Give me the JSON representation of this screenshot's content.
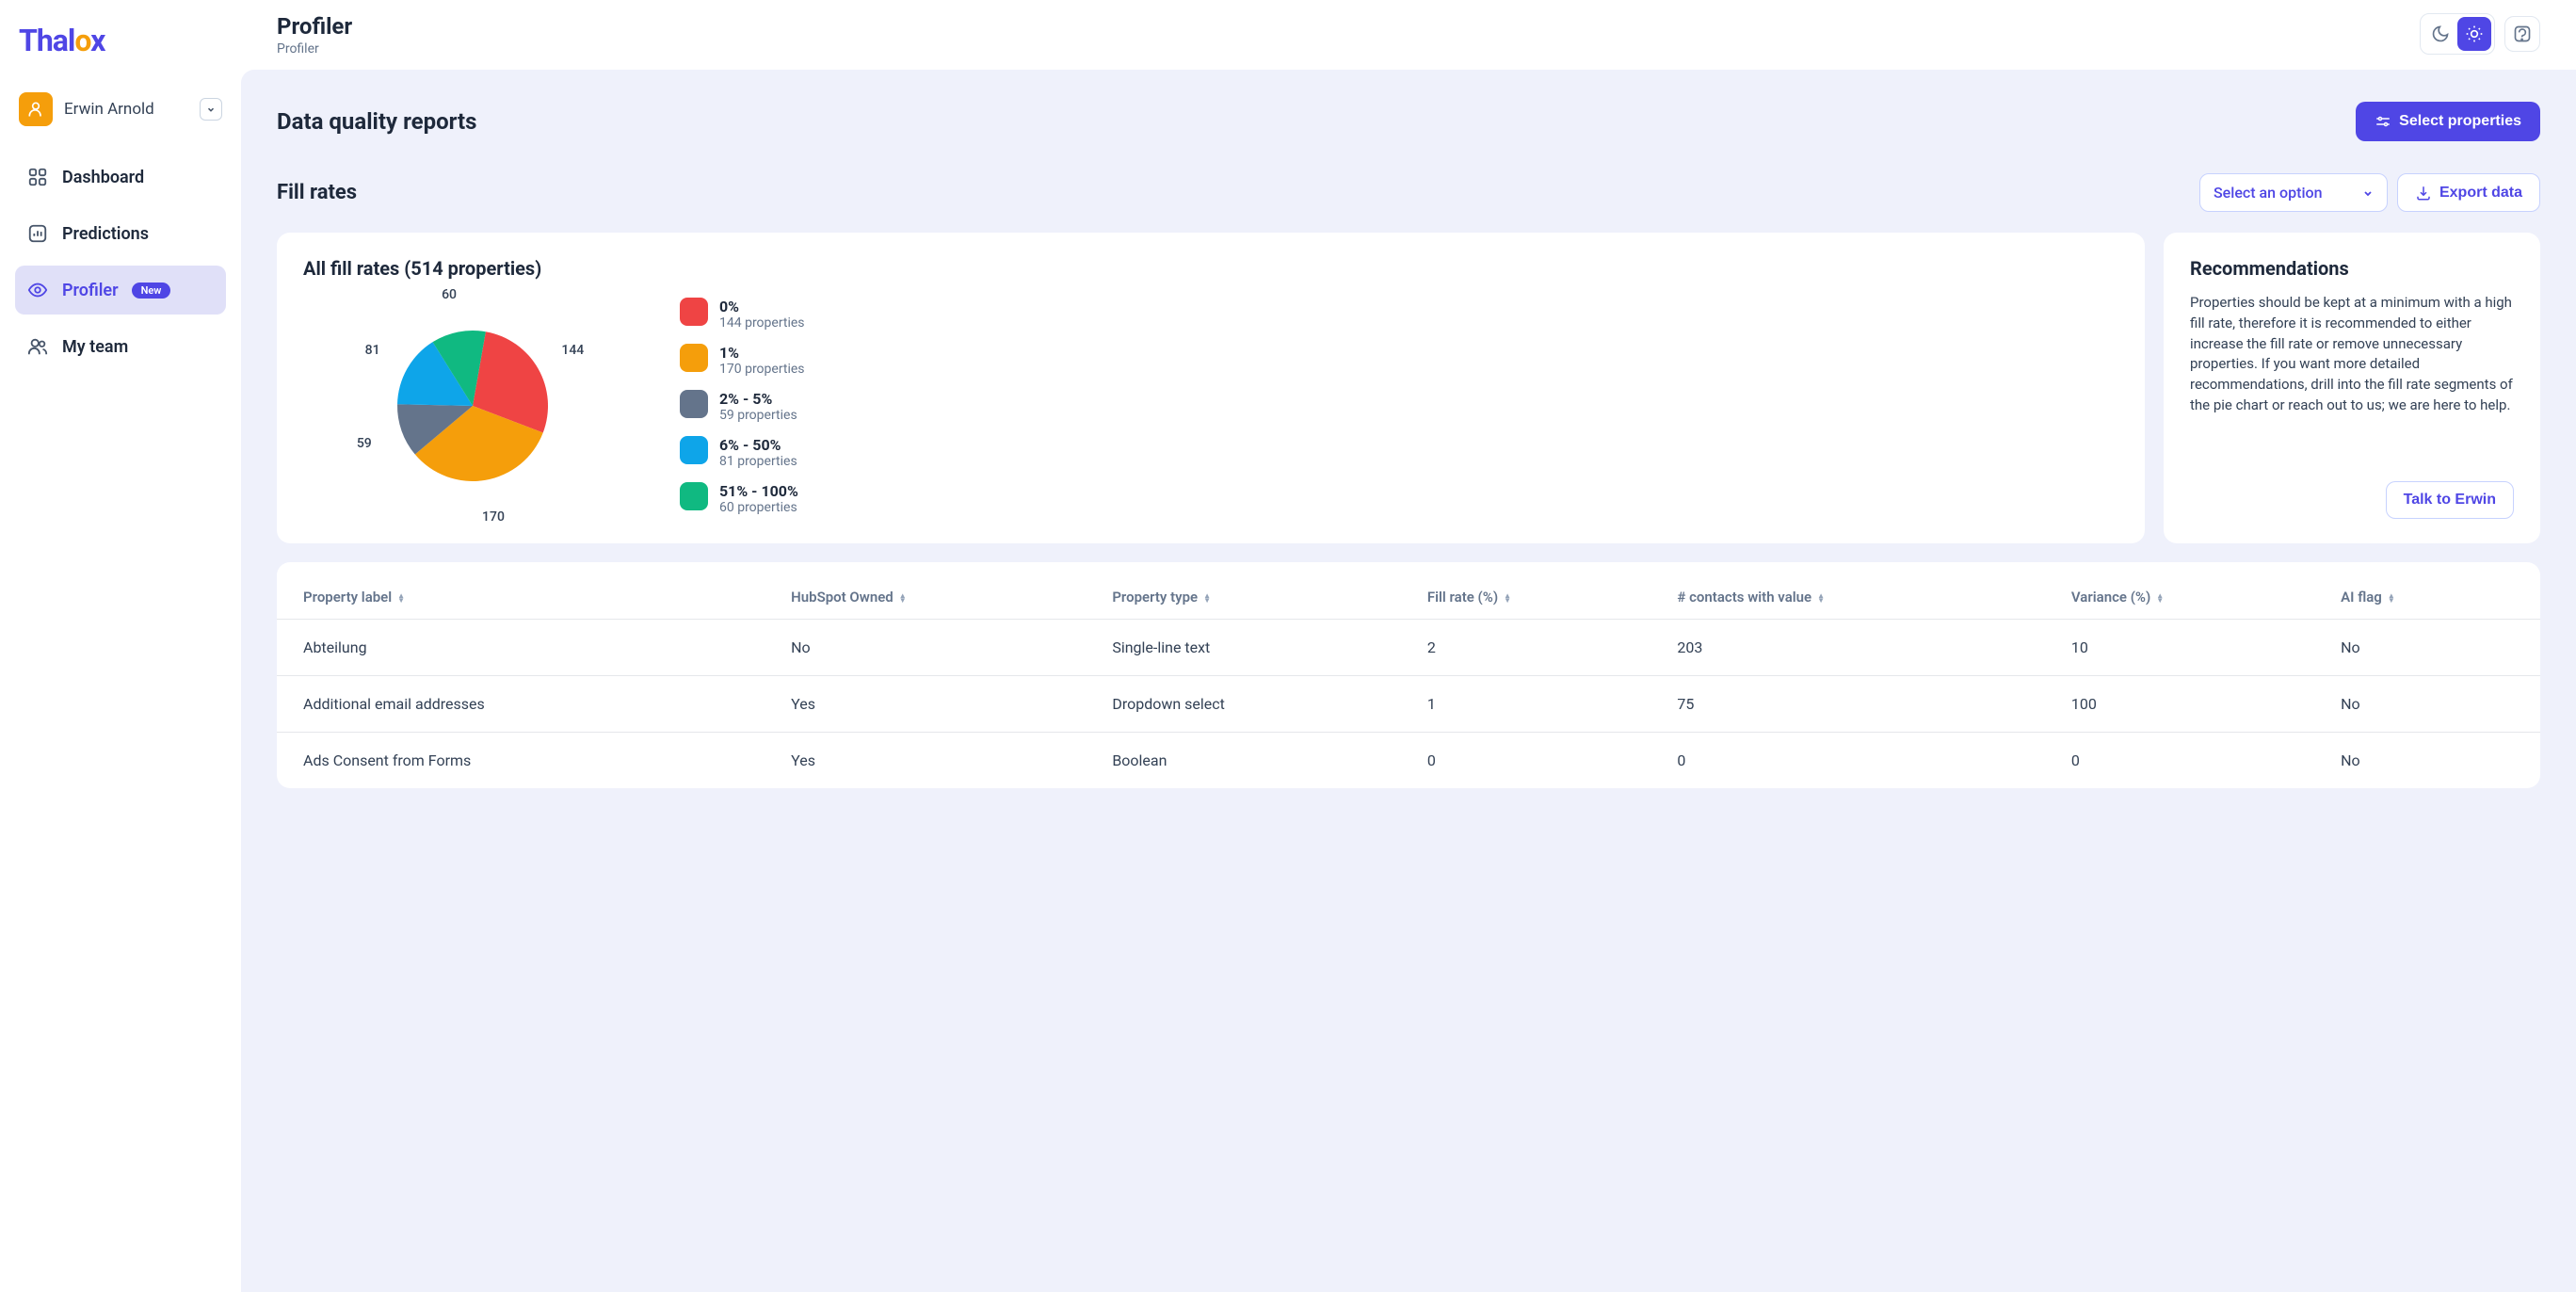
{
  "logo_prefix": "Thal",
  "logo_orange": "o",
  "logo_suffix": "x",
  "user": {
    "name": "Erwin Arnold"
  },
  "nav": {
    "items": [
      {
        "label": "Dashboard",
        "key": "dashboard"
      },
      {
        "label": "Predictions",
        "key": "predictions"
      },
      {
        "label": "Profiler",
        "key": "profiler",
        "badge": "New",
        "active": true
      },
      {
        "label": "My team",
        "key": "myteam"
      }
    ]
  },
  "header": {
    "title": "Profiler",
    "subtitle": "Profiler"
  },
  "section": {
    "title": "Data quality reports",
    "select_props_label": "Select properties"
  },
  "fillrates": {
    "title": "Fill rates",
    "option_placeholder": "Select an option",
    "export_label": "Export data",
    "chart_title": "All fill rates (514 properties)"
  },
  "chart_data": {
    "type": "pie",
    "title": "All fill rates (514 properties)",
    "categories": [
      "0%",
      "1%",
      "2% - 5%",
      "6% - 50%",
      "51% - 100%"
    ],
    "values": [
      144,
      170,
      59,
      81,
      60
    ],
    "value_labels": [
      "144 properties",
      "170 properties",
      "59 properties",
      "81 properties",
      "60 properties"
    ],
    "colors": [
      "#ef4444",
      "#f59e0b",
      "#64748b",
      "#0ea5e9",
      "#10b981"
    ]
  },
  "recommendations": {
    "title": "Recommendations",
    "text": "Properties should be kept at a minimum with a high fill rate, therefore it is recommended to either increase the fill rate or remove unnecessary properties. If you want more detailed recommendations, drill into the fill rate segments of the pie chart or reach out to us; we are here to help.",
    "cta": "Talk to Erwin"
  },
  "table": {
    "columns": [
      "Property label",
      "HubSpot Owned",
      "Property type",
      "Fill rate (%)",
      "# contacts with value",
      "Variance (%)",
      "AI flag"
    ],
    "rows": [
      {
        "c": [
          "Abteilung",
          "No",
          "Single-line text",
          "2",
          "203",
          "10",
          "No"
        ]
      },
      {
        "c": [
          "Additional email addresses",
          "Yes",
          "Dropdown select",
          "1",
          "75",
          "100",
          "No"
        ]
      },
      {
        "c": [
          "Ads Consent from Forms",
          "Yes",
          "Boolean",
          "0",
          "0",
          "0",
          "No"
        ]
      }
    ]
  }
}
